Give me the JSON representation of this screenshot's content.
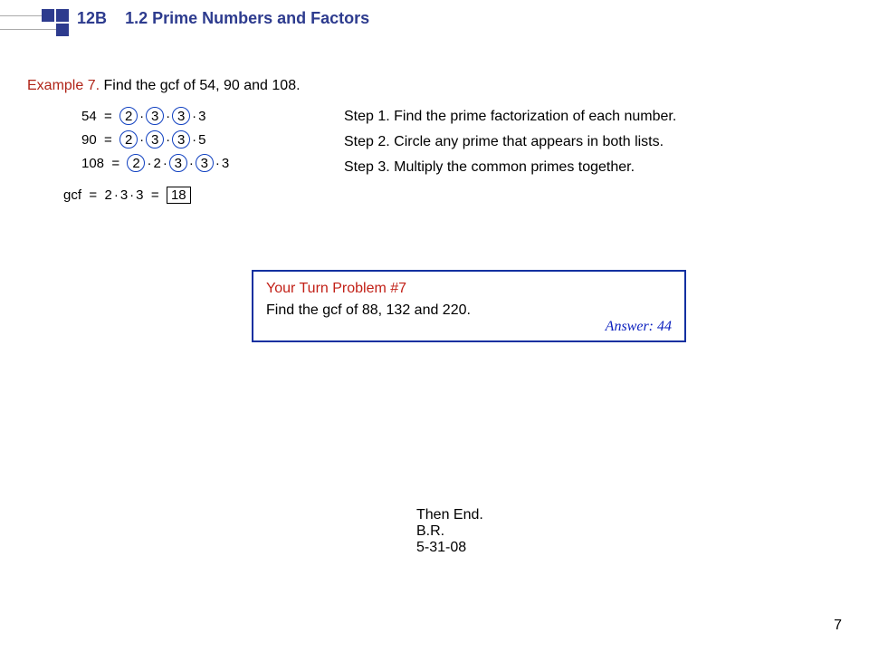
{
  "header": {
    "code": "12B",
    "title": "1.2  Prime Numbers and Factors"
  },
  "example": {
    "label": "Example 7.",
    "text": "  Find the gcf of 54, 90 and 108."
  },
  "work": {
    "rows": [
      {
        "n": "54",
        "parts": [
          "2",
          "·",
          "3",
          "·",
          "3",
          "·",
          "3"
        ]
      },
      {
        "n": "90",
        "parts": [
          "2",
          "·",
          "3",
          "·",
          "3",
          "·",
          "5"
        ]
      },
      {
        "n": "108",
        "parts": [
          "2",
          "·",
          "2",
          "·",
          "3",
          "·",
          "3",
          "·",
          "3"
        ]
      }
    ],
    "gcf_label": "gcf",
    "gcf_parts": [
      "2",
      "·",
      "3",
      "·",
      "3"
    ],
    "gcf_result": "18"
  },
  "steps": [
    {
      "label": "Step 1.",
      "text": "  Find the prime factorization of each number."
    },
    {
      "label": "Step 2.",
      "text": "  Circle any prime that appears in both lists."
    },
    {
      "label": "Step 3.",
      "text": "  Multiply the common primes together."
    }
  ],
  "your_turn": {
    "title": "Your Turn Problem #7",
    "prompt": "Find the gcf of 88, 132 and 220.",
    "answer": "Answer: 44"
  },
  "end": {
    "line1": "Then End.",
    "line2": "B.R.",
    "line3": "5-31-08"
  },
  "page_number": "7"
}
